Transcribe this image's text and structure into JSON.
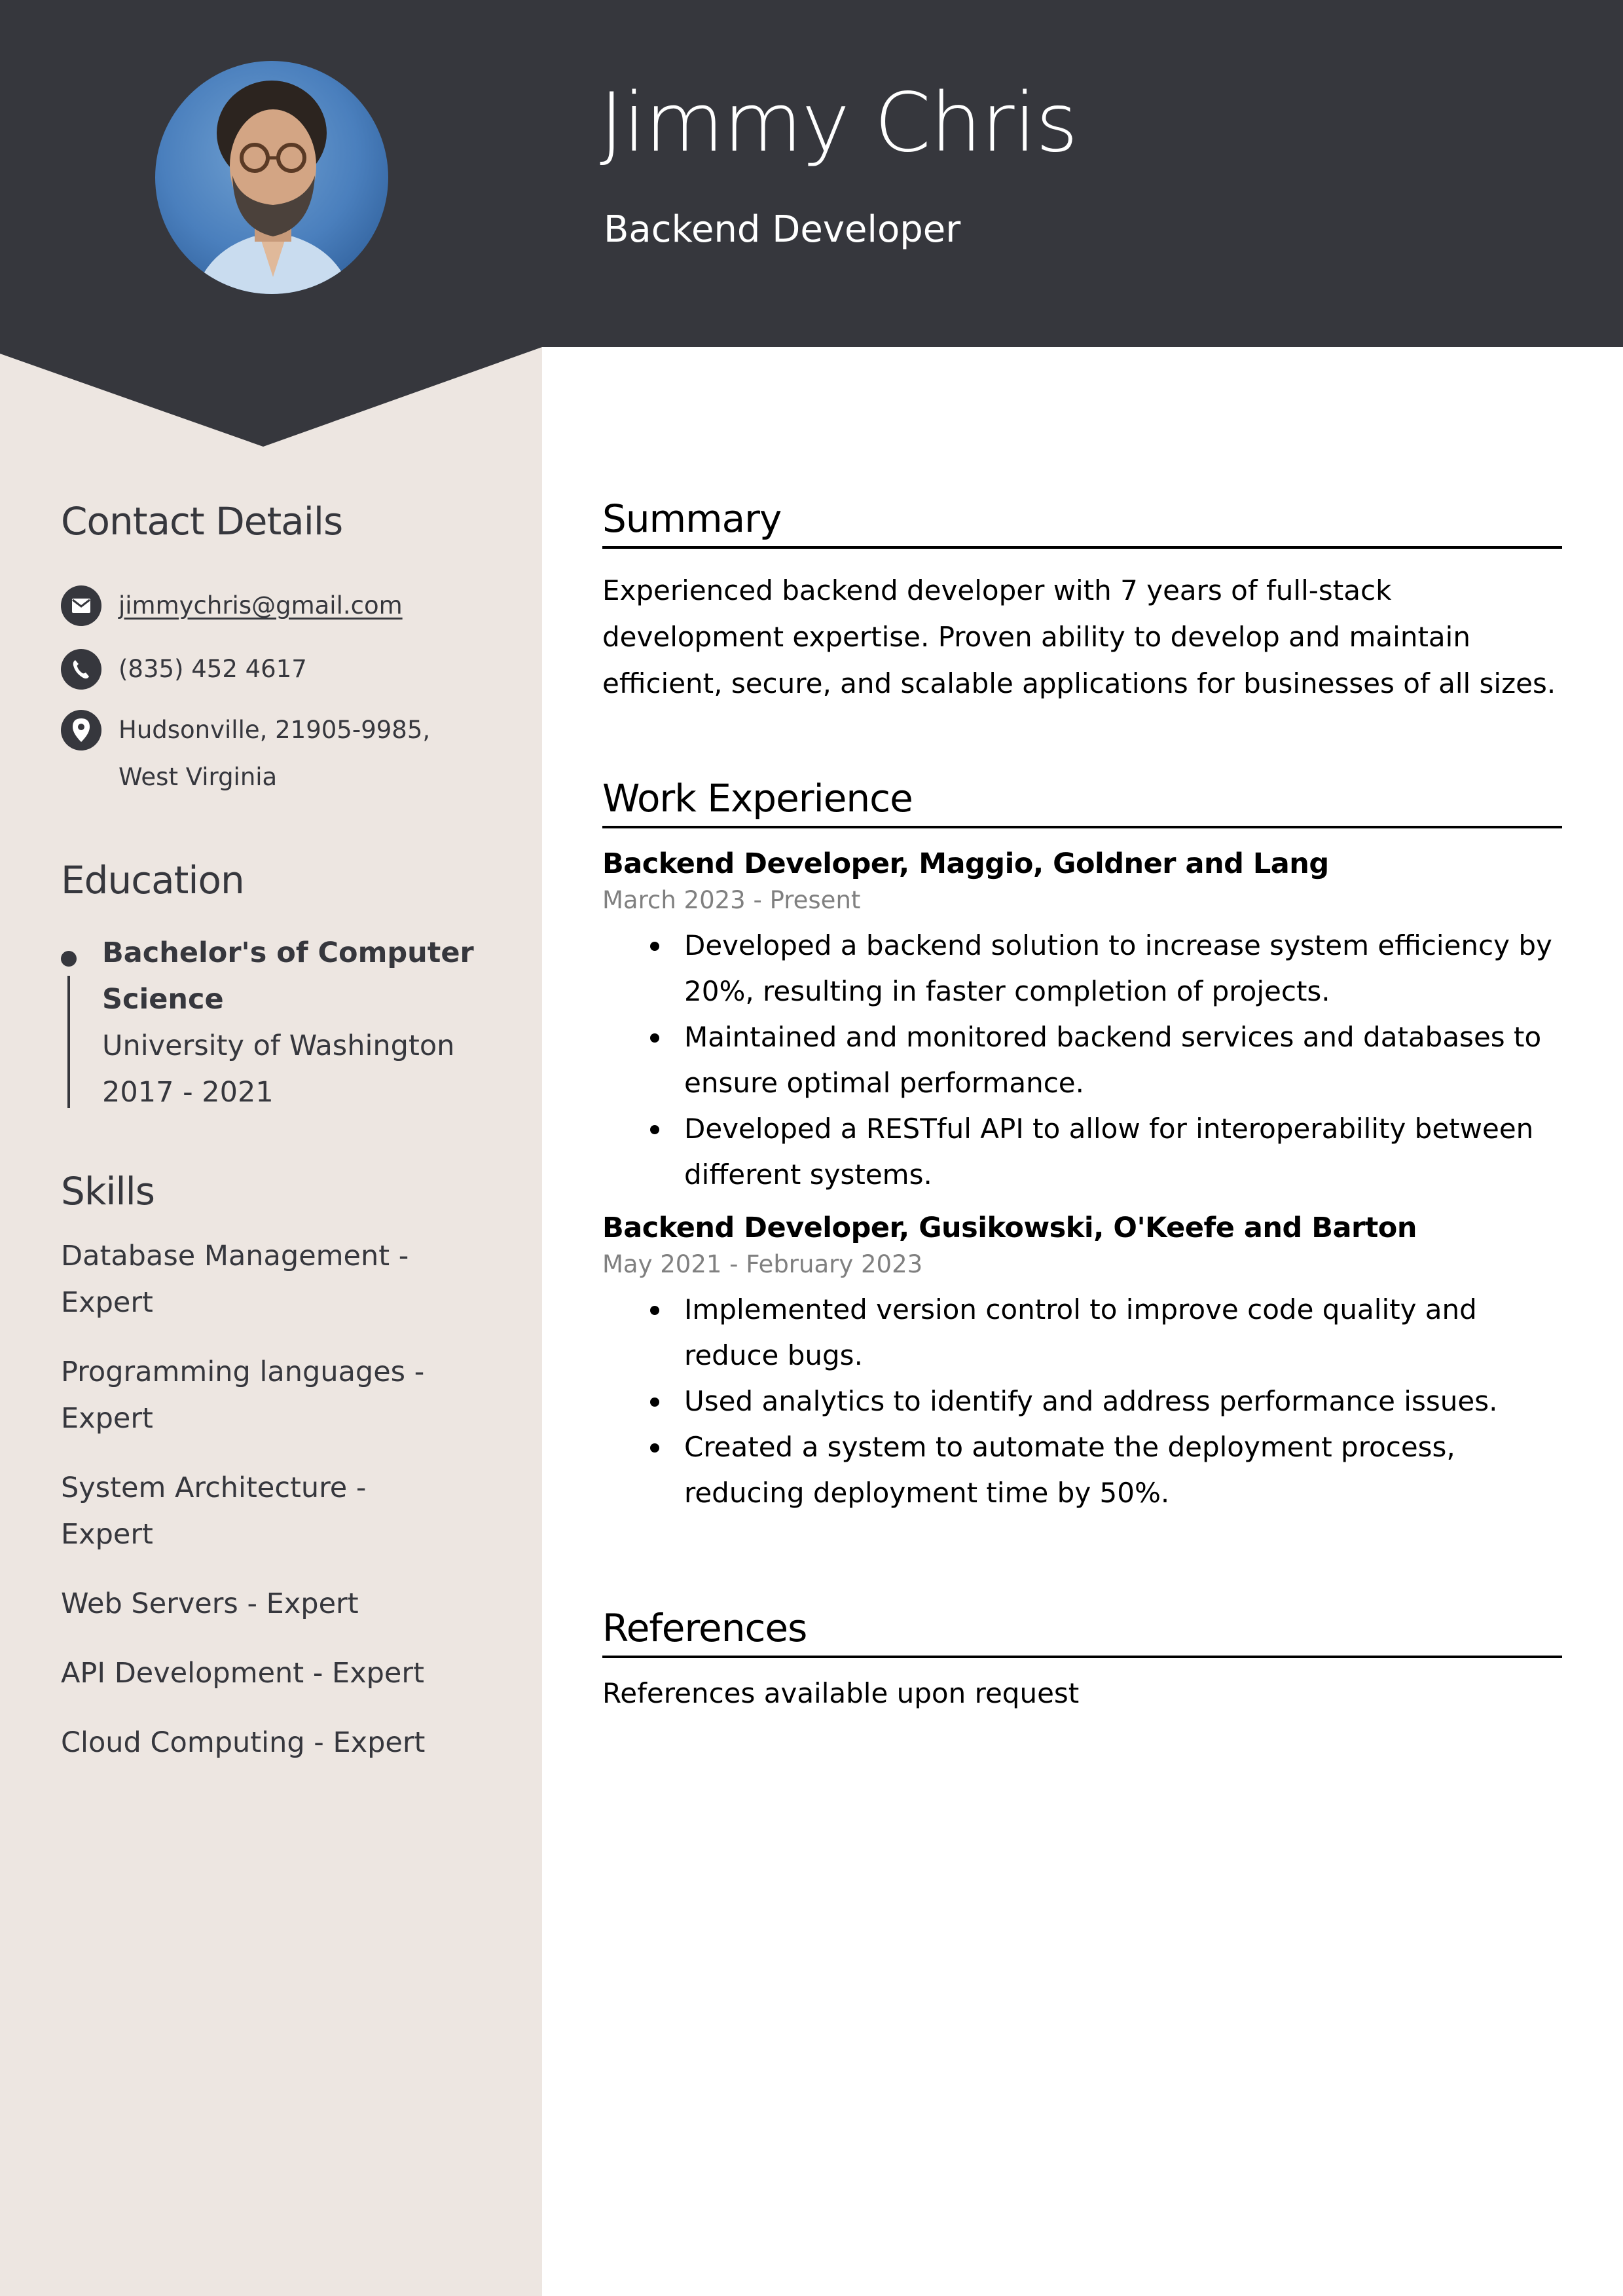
{
  "colors": {
    "header_bg": "#36373d",
    "sidebar_bg": "#ede6e1",
    "main_bg": "#ffffff",
    "muted_text": "#808080"
  },
  "header": {
    "name": "Jimmy Chris",
    "role": "Backend Developer",
    "photo": "profile-photo"
  },
  "sidebar": {
    "contact": {
      "title": "Contact Details",
      "items": [
        {
          "icon": "envelope-icon",
          "text": "jimmychris@gmail.com"
        },
        {
          "icon": "phone-icon",
          "text": "(835) 452 4617"
        },
        {
          "icon": "location-pin-icon",
          "text": "Hudsonville, 21905-9985, West Virginia"
        }
      ]
    },
    "education": {
      "title": "Education",
      "items": [
        {
          "degree": "Bachelor's of Computer Science",
          "school": "University of Washington",
          "years": "2017 - 2021"
        }
      ]
    },
    "skills": {
      "title": "Skills",
      "items": [
        "Database Management - Expert",
        "Programming languages - Expert",
        "System Architecture - Expert",
        "Web Servers - Expert",
        "API Development - Expert",
        "Cloud Computing - Expert"
      ]
    }
  },
  "main": {
    "summary": {
      "title": "Summary",
      "text": "Experienced backend developer with 7 years of full-stack development expertise. Proven ability to develop and maintain efficient, secure, and scalable applications for businesses of all sizes."
    },
    "experience": {
      "title": "Work Experience",
      "jobs": [
        {
          "title": "Backend Developer, Maggio, Goldner and Lang",
          "dates": "March 2023 - Present",
          "bullets": [
            "Developed a backend solution to increase system efficiency by 20%, resulting in faster completion of projects.",
            "Maintained and monitored backend services and databases to ensure optimal performance.",
            "Developed a RESTful API to allow for interoperability between different systems."
          ]
        },
        {
          "title": "Backend Developer, Gusikowski, O'Keefe and Barton",
          "dates": "May 2021 - February 2023",
          "bullets": [
            "Implemented version control to improve code quality and reduce bugs.",
            "Used analytics to identify and address performance issues.",
            "Created a system to automate the deployment process, reducing deployment time by 50%."
          ]
        }
      ]
    },
    "references": {
      "title": "References",
      "text": "References available upon request"
    }
  }
}
